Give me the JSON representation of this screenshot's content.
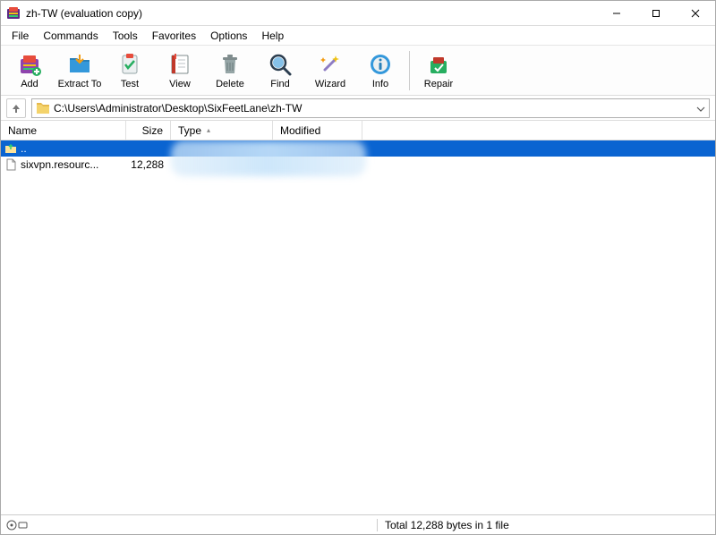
{
  "window": {
    "title": "zh-TW (evaluation copy)"
  },
  "menu": {
    "file": "File",
    "commands": "Commands",
    "tools": "Tools",
    "favorites": "Favorites",
    "options": "Options",
    "help": "Help"
  },
  "toolbar": {
    "add": "Add",
    "extract": "Extract To",
    "test": "Test",
    "view": "View",
    "delete": "Delete",
    "find": "Find",
    "wizard": "Wizard",
    "info": "Info",
    "repair": "Repair"
  },
  "nav": {
    "path": "C:\\Users\\Administrator\\Desktop\\SixFeetLane\\zh-TW"
  },
  "columns": {
    "name": "Name",
    "size": "Size",
    "type": "Type",
    "modified": "Modified"
  },
  "rows": [
    {
      "name": "..",
      "size": "",
      "type": "",
      "modified": "",
      "selected": true,
      "icon": "folder-up"
    },
    {
      "name": "sixvpn.resourc...",
      "size": "12,288",
      "type": "",
      "modified": "",
      "selected": false,
      "icon": "file"
    }
  ],
  "status": {
    "summary": "Total 12,288 bytes in 1 file"
  }
}
